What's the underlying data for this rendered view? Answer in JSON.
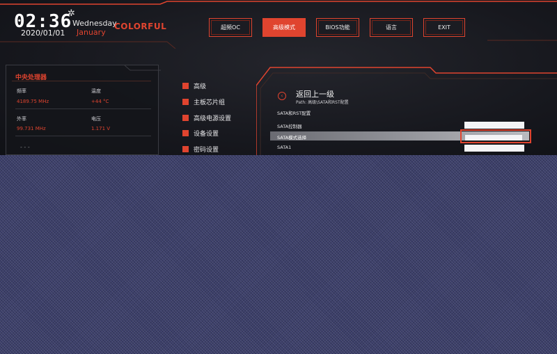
{
  "header": {
    "time": "02:36",
    "date": "2020/01/01",
    "weekday": "Wednesday",
    "month": "January",
    "brand": "COLORFUL",
    "settings_icon": "gear-icon"
  },
  "nav": {
    "items": [
      {
        "label": "超频OC",
        "active": false
      },
      {
        "label": "高级模式",
        "active": true
      },
      {
        "label": "BIOS功能",
        "active": false
      },
      {
        "label": "语言",
        "active": false
      },
      {
        "label": "EXIT",
        "active": false
      }
    ]
  },
  "cpu": {
    "title": "中央处理器",
    "freq_label": "频率",
    "freq_value": "4189.75 MHz",
    "temp_label": "温度",
    "temp_value": "+44 °C",
    "ext_freq_label": "外率",
    "ext_freq_value": "99.731 MHz",
    "voltage_label": "电压",
    "voltage_value": "1.171 V"
  },
  "menu": {
    "items": [
      {
        "label": "高级"
      },
      {
        "label": "主板芯片组"
      },
      {
        "label": "高级电源设置"
      },
      {
        "label": "设备设置"
      },
      {
        "label": "密码设置"
      }
    ]
  },
  "settings": {
    "back_label": "返回上一级",
    "path": "Path: 高级\\SATA和RST配置",
    "rows": [
      {
        "label": "SATA和RST配置"
      },
      {
        "label": "SATA控制器"
      },
      {
        "label": "SATA模式选择"
      },
      {
        "label": "SATA1"
      }
    ]
  },
  "colors": {
    "accent": "#e0442f",
    "background": "#17181e",
    "corruption": "#3c3f6a"
  }
}
